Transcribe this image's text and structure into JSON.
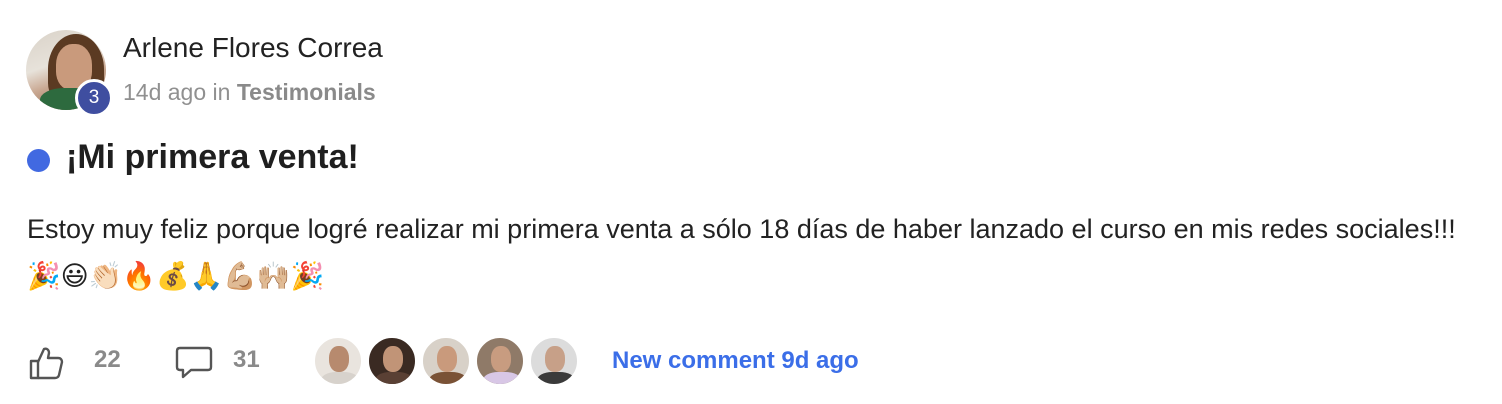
{
  "post": {
    "author": {
      "name": "Arlene Flores Correa",
      "level": "3",
      "avatar_icon": "user-avatar"
    },
    "meta": {
      "time": "14d ago",
      "in_word": "in",
      "category": "Testimonials"
    },
    "unread": true,
    "title": "¡Mi primera venta!",
    "body": "Estoy muy feliz porque logré realizar mi primera venta a sólo 18 días de haber lanzado el curso en mis redes sociales!!! 🎉😃👏🏻🔥💰🙏💪🏼🙌🏼🎉",
    "footer": {
      "like_icon": "thumbs-up-icon",
      "likes": "22",
      "comment_icon": "comment-bubble-icon",
      "comments": "31",
      "participants": [
        {
          "name": "participant-1"
        },
        {
          "name": "participant-2"
        },
        {
          "name": "participant-3"
        },
        {
          "name": "participant-4"
        },
        {
          "name": "participant-5"
        }
      ],
      "new_comment": "New comment 9d ago"
    }
  },
  "colors": {
    "unread_dot": "#4169e1",
    "level_badge": "#3f4ea0",
    "link": "#3b6ee8",
    "muted": "#909090"
  }
}
